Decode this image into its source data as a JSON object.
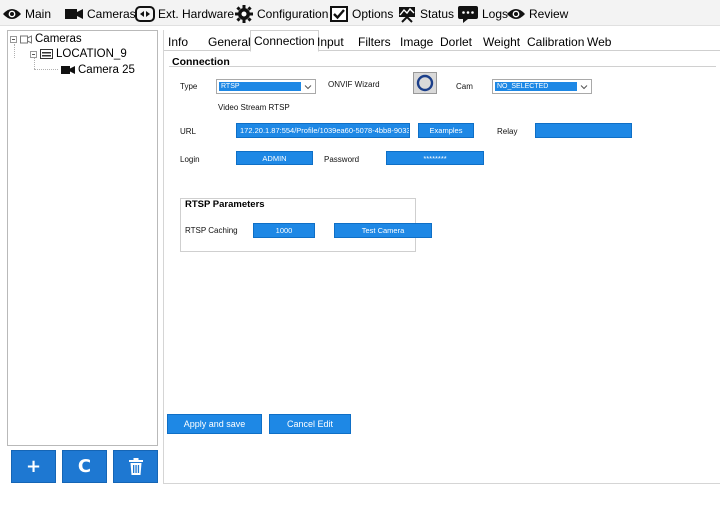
{
  "menu": [
    {
      "label": "Main",
      "icon": "eye-icon"
    },
    {
      "label": "Cameras",
      "icon": "camera-icon"
    },
    {
      "label": "Ext. Hardware",
      "icon": "hardware-icon"
    },
    {
      "label": "Configuration",
      "icon": "gear-icon"
    },
    {
      "label": "Options",
      "icon": "checkbox-icon"
    },
    {
      "label": "Status",
      "icon": "status-icon"
    },
    {
      "label": "Logs",
      "icon": "logs-icon"
    },
    {
      "label": "Review",
      "icon": "eye-icon"
    }
  ],
  "tree": {
    "root": "Cameras",
    "location": "LOCATION_9",
    "camera": "Camera 25"
  },
  "actions": {
    "add": "+",
    "refresh": "C",
    "delete": "delete-icon"
  },
  "tabs": [
    "Info",
    "General",
    "Connection",
    "Input",
    "Filters",
    "Image",
    "Dorlet",
    "Weight",
    "Calibration",
    "Web"
  ],
  "active_tab": "Connection",
  "connection": {
    "section_title": "Connection",
    "type_label": "Type",
    "type_value": "RTSP",
    "onvif_label": "ONVIF Wizard",
    "cam_label": "Cam",
    "cam_value": "NO_SELECTED",
    "stream_note": "Video Stream RTSP",
    "url_label": "URL",
    "url_value": "172.20.1.87:554/Profile/1039ea60-5078-4bb8-9033",
    "examples_label": "Examples",
    "relay_label": "Relay",
    "relay_value": "",
    "login_label": "Login",
    "login_value": "ADMIN",
    "password_label": "Password",
    "password_value": "********"
  },
  "rtsp": {
    "title": "RTSP Parameters",
    "caching_label": "RTSP Caching",
    "caching_value": "1000",
    "test_label": "Test Camera"
  },
  "footer": {
    "apply_label": "Apply and save",
    "cancel_label": "Cancel Edit"
  },
  "colors": {
    "accent": "#1e88e5",
    "accent_dark": "#1e78d2"
  }
}
